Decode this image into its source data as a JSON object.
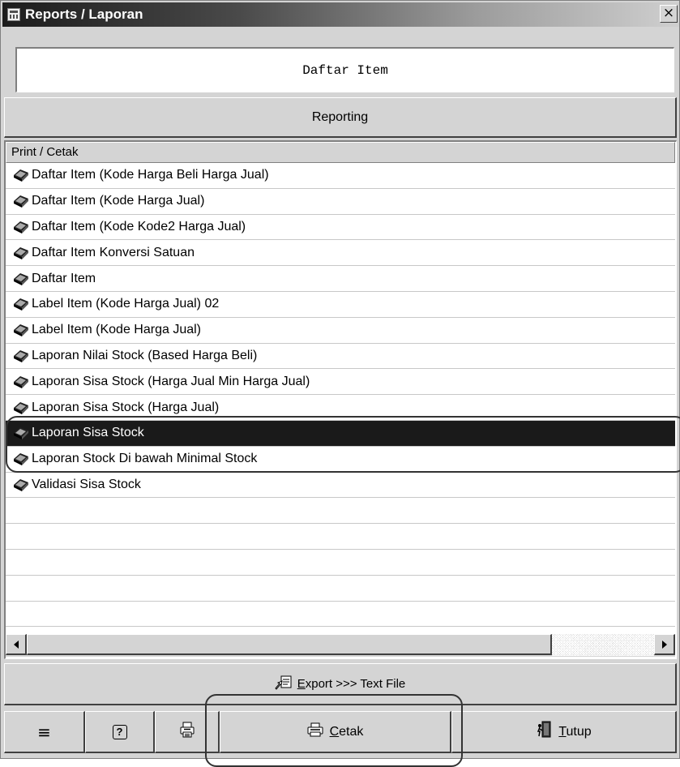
{
  "window": {
    "title": "Reports / Laporan",
    "close_label": "×"
  },
  "panel": {
    "title": "Daftar Item"
  },
  "reporting_button": "Reporting",
  "list": {
    "header": "Print / Cetak",
    "items": [
      {
        "label": "Daftar Item (Kode Harga Beli Harga Jual)",
        "selected": false
      },
      {
        "label": "Daftar Item (Kode Harga Jual)",
        "selected": false
      },
      {
        "label": "Daftar Item (Kode Kode2 Harga Jual)",
        "selected": false
      },
      {
        "label": "Daftar Item Konversi Satuan",
        "selected": false
      },
      {
        "label": "Daftar Item",
        "selected": false
      },
      {
        "label": "Label Item (Kode Harga Jual) 02",
        "selected": false
      },
      {
        "label": "Label Item (Kode Harga Jual)",
        "selected": false
      },
      {
        "label": "Laporan Nilai Stock (Based Harga Beli)",
        "selected": false
      },
      {
        "label": "Laporan Sisa Stock (Harga Jual Min Harga Jual)",
        "selected": false
      },
      {
        "label": "Laporan Sisa Stock (Harga Jual)",
        "selected": false
      },
      {
        "label": "Laporan Sisa Stock",
        "selected": true
      },
      {
        "label": "Laporan Stock Di bawah Minimal Stock",
        "selected": false
      },
      {
        "label": "Validasi Sisa Stock",
        "selected": false
      },
      {
        "label": "",
        "selected": false
      },
      {
        "label": "",
        "selected": false
      },
      {
        "label": "",
        "selected": false
      },
      {
        "label": "",
        "selected": false
      },
      {
        "label": "",
        "selected": false
      }
    ],
    "item_icon": "report-book-icon"
  },
  "toolbar": {
    "export_label": "Export >>> Text File",
    "menu_label": "≡",
    "help_label": "?",
    "cetak_label": "Cetak",
    "tutup_label": "Tutup"
  },
  "colors": {
    "selection": "#1a1a1a",
    "face": "#d4d4d4"
  }
}
